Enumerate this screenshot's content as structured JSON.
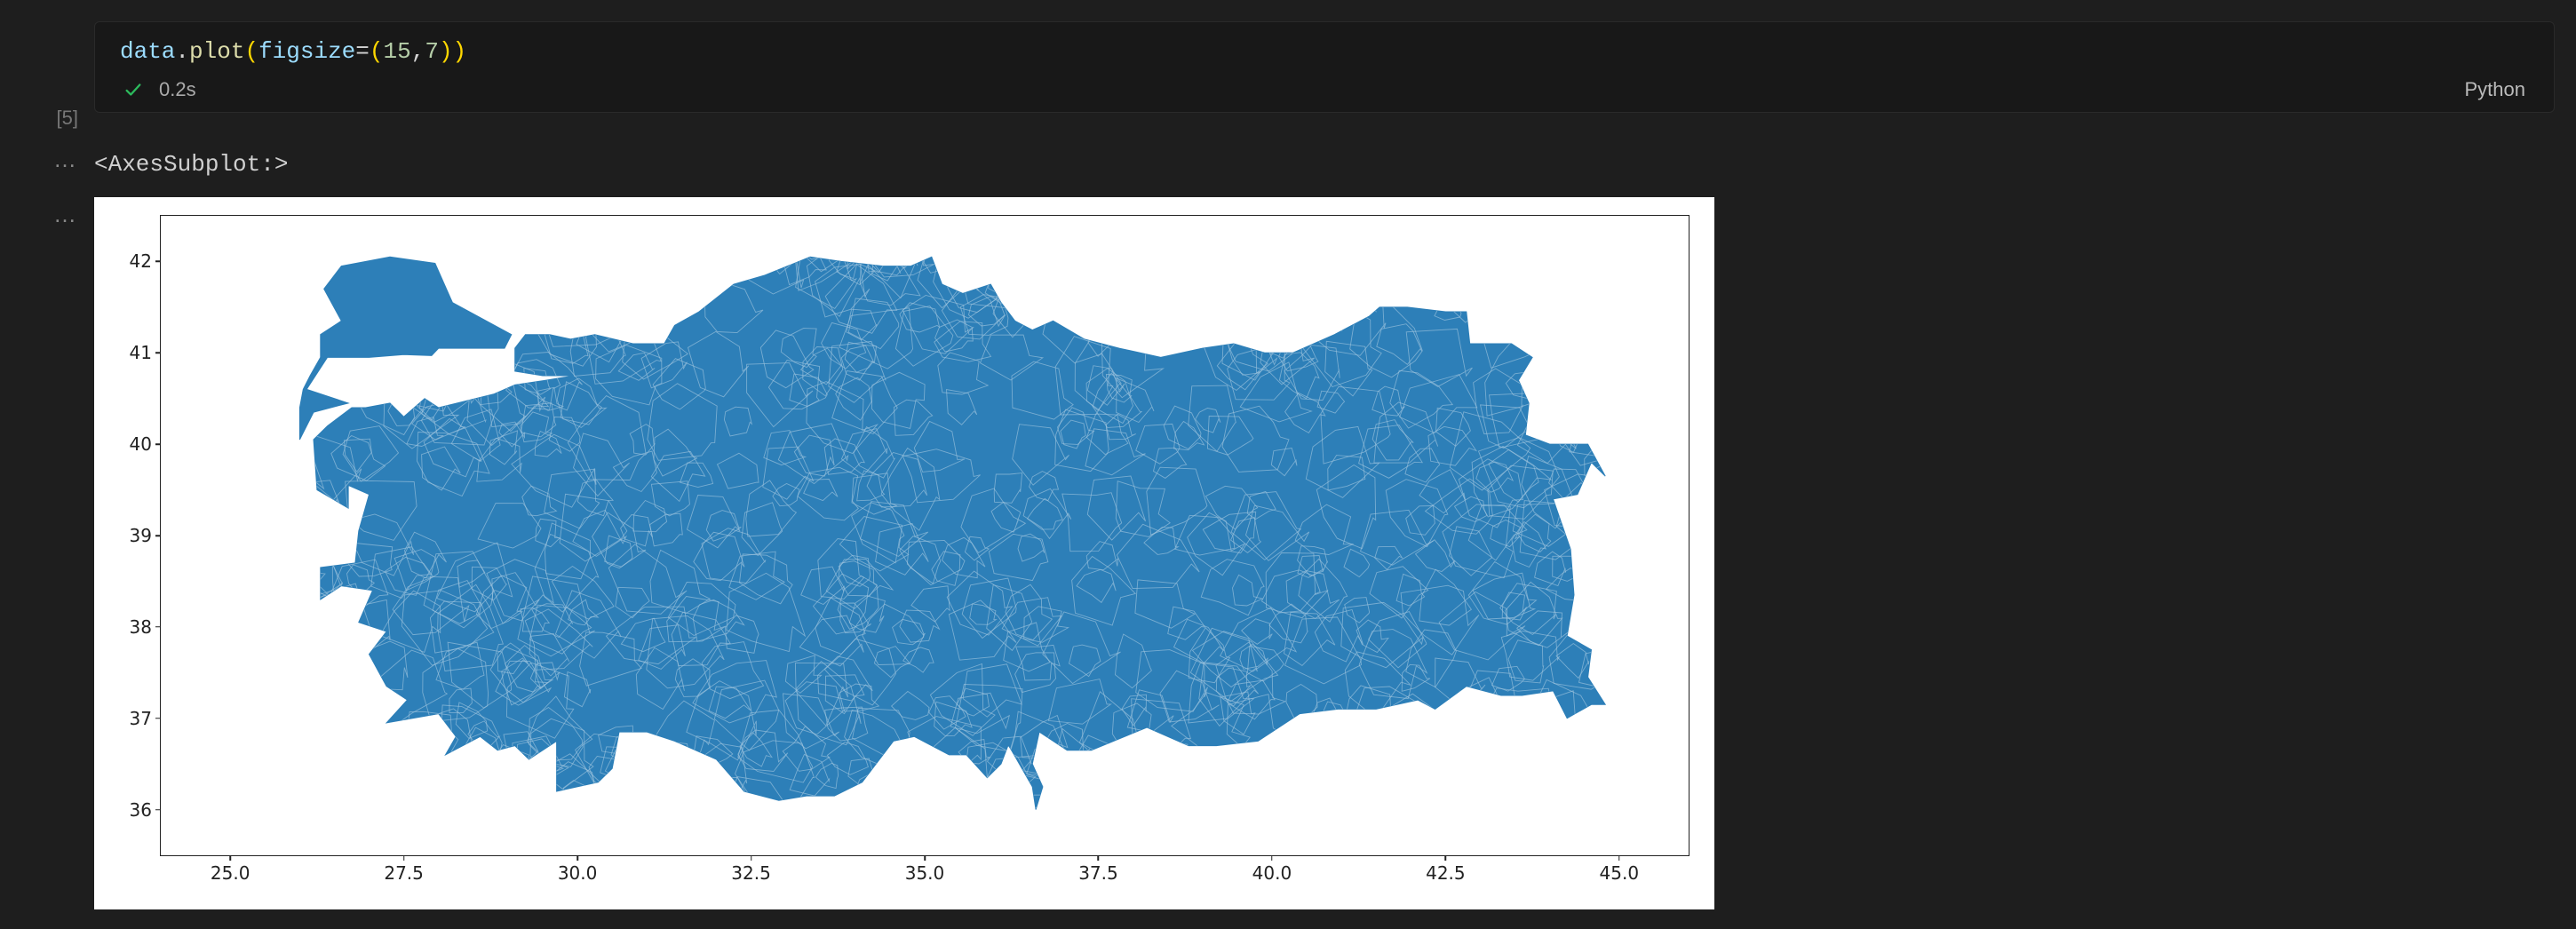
{
  "cell": {
    "exec_count": "[5]",
    "code_tokens": {
      "ident": "data",
      "dot": ".",
      "method": "plot",
      "open": "(",
      "kwarg": "figsize",
      "eq": "=",
      "open2": "(",
      "n1": "15",
      "comma": ",",
      "n2": "7",
      "close2": ")",
      "close": ")"
    },
    "status": {
      "elapsed": "0.2s",
      "language": "Python"
    }
  },
  "output": {
    "ellipsis": "…",
    "text": "<AxesSubplot:>"
  },
  "chart_data": {
    "type": "area",
    "title": "",
    "xlabel": "",
    "ylabel": "",
    "xlim": [
      24.0,
      46.0
    ],
    "ylim": [
      35.5,
      42.5
    ],
    "x_ticks": [
      25.0,
      27.5,
      30.0,
      32.5,
      35.0,
      37.5,
      40.0,
      42.5,
      45.0
    ],
    "y_ticks": [
      36,
      37,
      38,
      39,
      40,
      41,
      42
    ],
    "fill_color": "#2d7fb8",
    "outline_color": "#9fc5de",
    "description": "Choropleth-style filled polygon map of Turkey with district boundaries, plotted in longitude (x) and latitude (y)."
  }
}
